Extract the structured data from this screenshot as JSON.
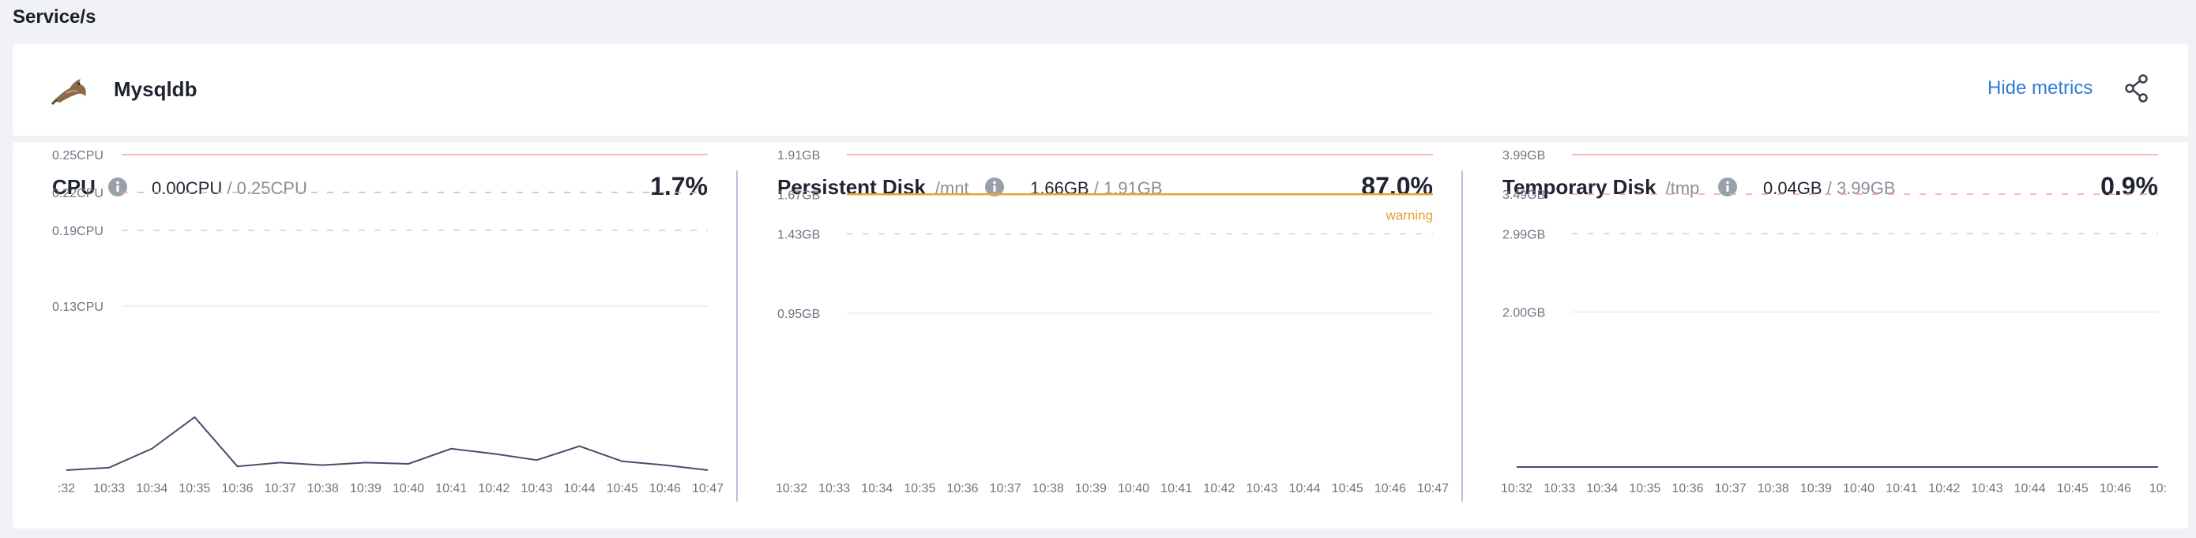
{
  "page": {
    "title": "Service/s"
  },
  "service": {
    "name": "Mysqldb",
    "logo_icon": "mysql-dolphin-icon",
    "hide_metrics_label": "Hide metrics",
    "share_icon": "share-icon"
  },
  "colors": {
    "limit_line": "#f2a69b",
    "critical_line": "#f5a5a0",
    "warning_line": "#f7c99a",
    "warning_active": "#e8a530",
    "series": "#4a4c6a",
    "link": "#2f7bd6"
  },
  "panels": [
    {
      "title": "CPU",
      "subtitle": "",
      "used": "0.00CPU",
      "limit": "/ 0.25CPU",
      "percent": "1.7%",
      "chart_data": {
        "type": "line",
        "x": [
          ":32",
          "10:33",
          "10:34",
          "10:35",
          "10:36",
          "10:37",
          "10:38",
          "10:39",
          "10:40",
          "10:41",
          "10:42",
          "10:43",
          "10:44",
          "10:45",
          "10:46",
          "10:47"
        ],
        "y_ticks": [
          {
            "label": "0.25CPU",
            "value": 0.25,
            "style": "limit"
          },
          {
            "label": "0.22CPU",
            "value": 0.22,
            "style": "critical"
          },
          {
            "label": "0.19CPU",
            "value": 0.19,
            "style": "warning"
          },
          {
            "label": "0.13CPU",
            "value": 0.13,
            "style": "grid"
          }
        ],
        "ylim": [
          0,
          0.25
        ],
        "series": [
          {
            "values": [
              0.0,
              0.002,
              0.017,
              0.042,
              0.003,
              0.006,
              0.004,
              0.006,
              0.005,
              0.017,
              0.013,
              0.008,
              0.019,
              0.007,
              0.004,
              0.0
            ]
          }
        ],
        "annotations": []
      }
    },
    {
      "title": "Persistent Disk",
      "subtitle": "/mnt",
      "used": "1.66GB",
      "limit": "/ 1.91GB",
      "percent": "87.0%",
      "chart_data": {
        "type": "line",
        "x": [
          "10:32",
          "10:33",
          "10:34",
          "10:35",
          "10:36",
          "10:37",
          "10:38",
          "10:39",
          "10:40",
          "10:41",
          "10:42",
          "10:43",
          "10:44",
          "10:45",
          "10:46",
          "10:47"
        ],
        "y_ticks": [
          {
            "label": "1.91GB",
            "value": 1.91,
            "style": "limit"
          },
          {
            "label": "1.67GB",
            "value": 1.67,
            "style": "warning-active"
          },
          {
            "label": "1.43GB",
            "value": 1.43,
            "style": "warning"
          },
          {
            "label": "0.95GB",
            "value": 0.95,
            "style": "grid"
          }
        ],
        "ylim": [
          0,
          1.91
        ],
        "series": [],
        "annotations": [
          {
            "label": "warning",
            "value": 1.67
          }
        ]
      }
    },
    {
      "title": "Temporary Disk",
      "subtitle": "/tmp",
      "used": "0.04GB",
      "limit": "/ 3.99GB",
      "percent": "0.9%",
      "chart_data": {
        "type": "line",
        "x": [
          "10:32",
          "10:33",
          "10:34",
          "10:35",
          "10:36",
          "10:37",
          "10:38",
          "10:39",
          "10:40",
          "10:41",
          "10:42",
          "10:43",
          "10:44",
          "10:45",
          "10:46",
          "10:"
        ],
        "y_ticks": [
          {
            "label": "3.99GB",
            "value": 3.99,
            "style": "limit"
          },
          {
            "label": "3.49GB",
            "value": 3.49,
            "style": "critical"
          },
          {
            "label": "2.99GB",
            "value": 2.99,
            "style": "warning"
          },
          {
            "label": "2.00GB",
            "value": 2.0,
            "style": "grid"
          }
        ],
        "ylim": [
          0,
          3.99
        ],
        "series": [
          {
            "values": [
              0.04,
              0.04,
              0.04,
              0.04,
              0.04,
              0.04,
              0.04,
              0.04,
              0.04,
              0.04,
              0.04,
              0.04,
              0.04,
              0.04,
              0.04,
              0.04
            ]
          }
        ],
        "annotations": []
      }
    }
  ]
}
